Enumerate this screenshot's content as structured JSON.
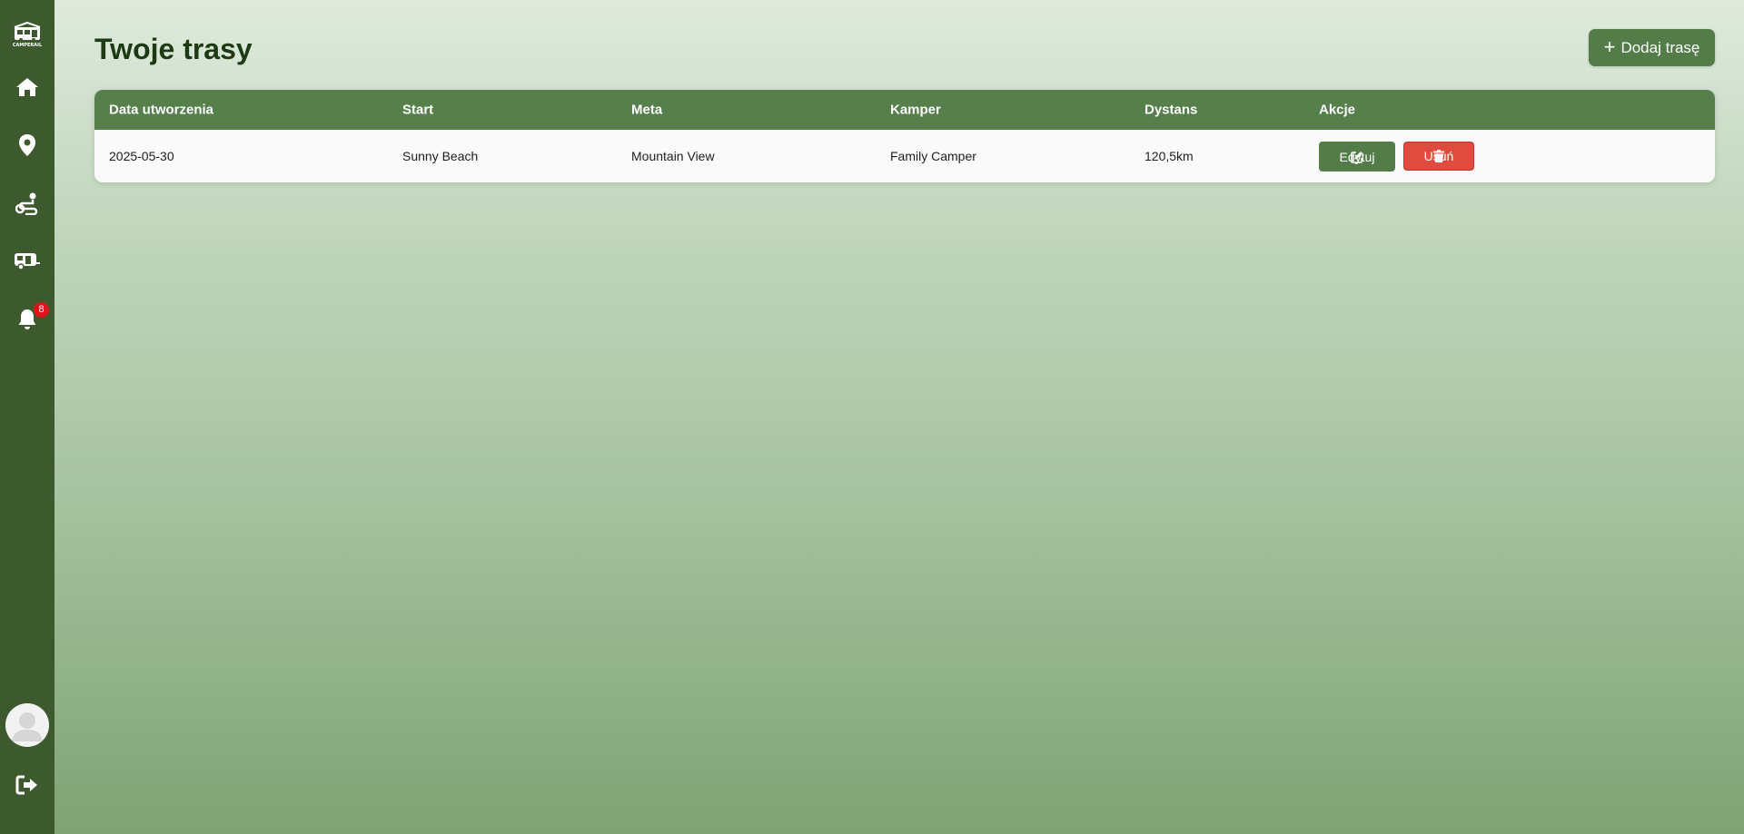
{
  "sidebar": {
    "logo_text": "CAMPERAIL",
    "items": [
      {
        "icon": "home-icon"
      },
      {
        "icon": "map-marker-icon"
      },
      {
        "icon": "route-icon"
      },
      {
        "icon": "camper-icon"
      },
      {
        "icon": "bell-icon",
        "badge": "8"
      }
    ],
    "avatar_icon": "user-avatar-icon",
    "logout_icon": "logout-icon"
  },
  "page": {
    "title": "Twoje trasy",
    "add_button_label": "Dodaj trasę"
  },
  "table": {
    "headers": [
      "Data utworzenia",
      "Start",
      "Meta",
      "Kamper",
      "Dystans",
      "Akcje"
    ],
    "rows": [
      {
        "date": "2025-05-30",
        "start": "Sunny Beach",
        "meta": "Mountain View",
        "camper": "Family Camper",
        "distance": "120,5km",
        "edit_label": "Edytuj",
        "delete_label": "Usuń"
      }
    ]
  },
  "colors": {
    "sidebar": "#3c5a2d",
    "primary": "#537c49",
    "danger": "#e04a3f",
    "badge": "#e0151b"
  }
}
